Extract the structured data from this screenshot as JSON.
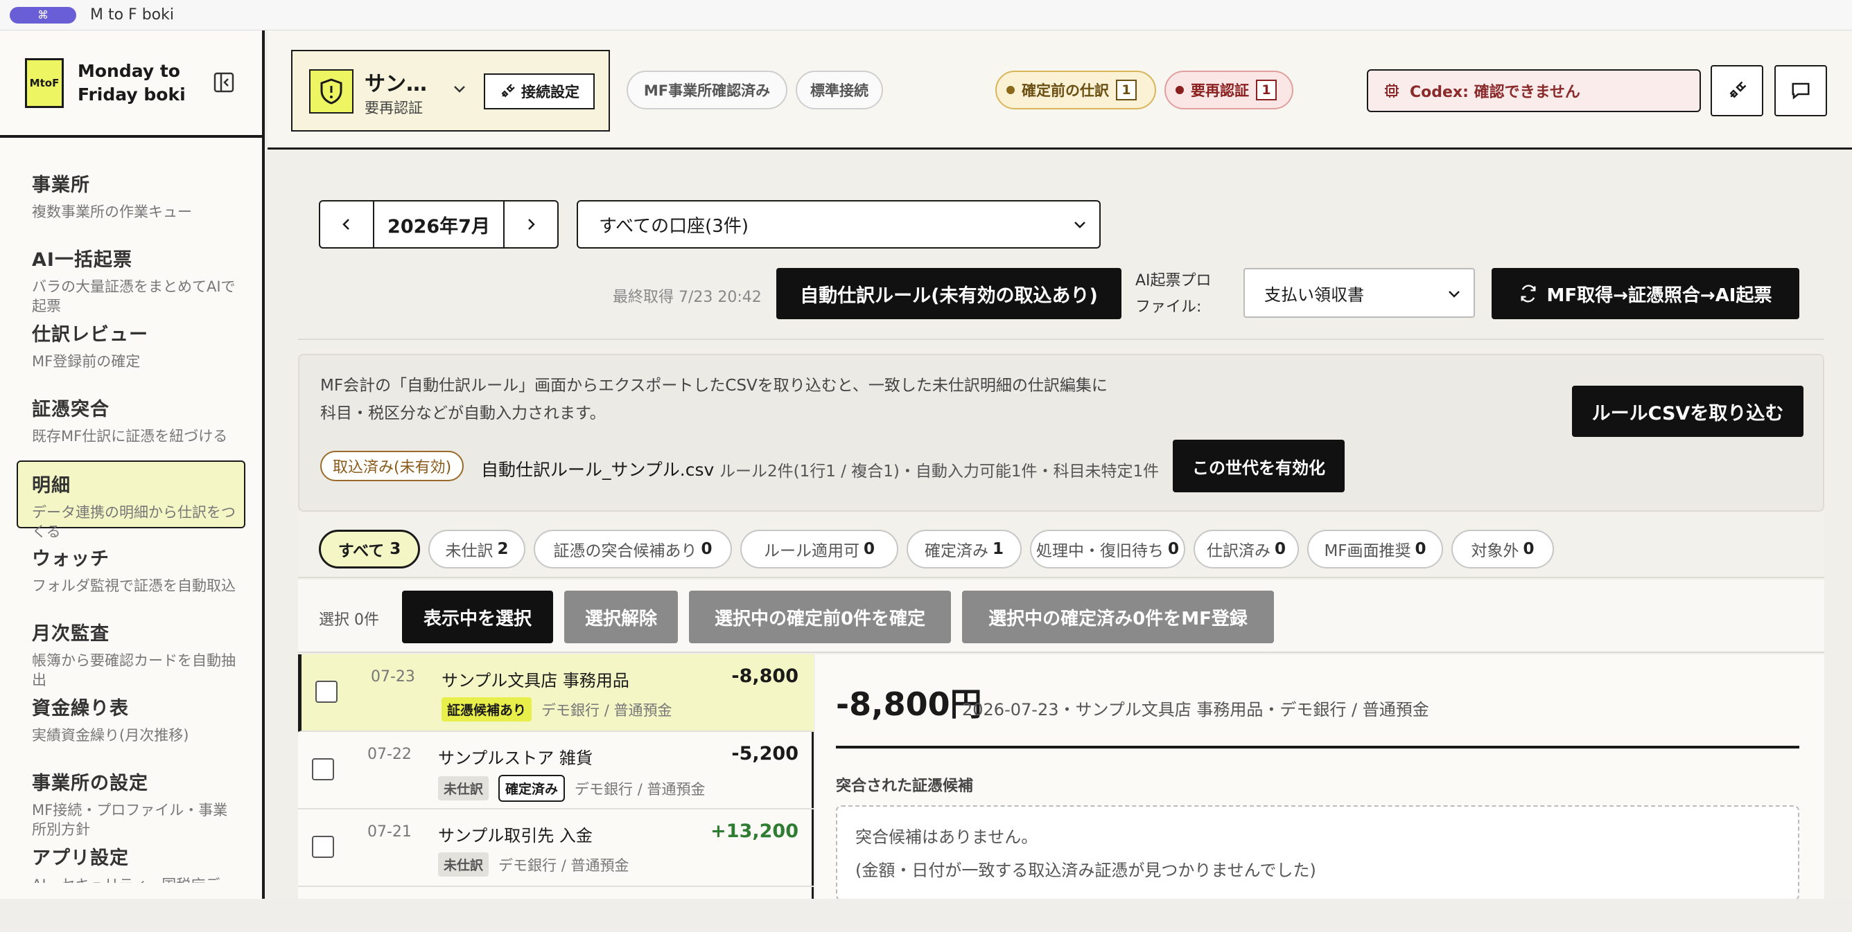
{
  "titlebar": {
    "pill_icon": "⌘",
    "title": "M to F boki"
  },
  "brand": {
    "logo": "MtoF",
    "line1": "Monday to",
    "line2": "Friday boki"
  },
  "sidebar": {
    "items": [
      {
        "label": "事業所",
        "desc": "複数事業所の作業キュー"
      },
      {
        "label": "AI一括起票",
        "desc": "バラの大量証憑をまとめてAIで起票"
      },
      {
        "label": "仕訳レビュー",
        "desc": "MF登録前の確定"
      },
      {
        "label": "証憑突合",
        "desc": "既存MF仕訳に証憑を紐づける"
      },
      {
        "label": "明細",
        "desc": "データ連携の明細から仕訳をつくる",
        "active": true
      },
      {
        "label": "ウォッチ",
        "desc": "フォルダ監視で証憑を自動取込"
      },
      {
        "label": "月次監査",
        "desc": "帳簿から要確認カードを自動抽出"
      },
      {
        "label": "資金繰り表",
        "desc": "実績資金繰り(月次推移)"
      },
      {
        "label": "事業所の設定",
        "desc": "MF接続・プロファイル・事業所別方針"
      },
      {
        "label": "アプリ設定",
        "desc": "AI・セキュリティ・国税庁データ・アプリ情報"
      }
    ]
  },
  "header": {
    "office_name": "サン…",
    "office_status": "要再認証",
    "connect_button": "接続設定",
    "pill_mf_confirmed": "MF事業所確認済み",
    "pill_standard": "標準接続",
    "status_pending": {
      "label": "確定前の仕訳",
      "count": "1",
      "color": "#b58a2a"
    },
    "status_reauth": {
      "label": "要再認証",
      "count": "1",
      "color": "#c0392b"
    },
    "codex": "Codex: 確認できません"
  },
  "main": {
    "month": "2026年7月",
    "account_select": "すべての口座(3件)",
    "last_fetch": "最終取得 7/23 20:42",
    "auto_rule_button": "自動仕訳ルール(未有効の取込あり)",
    "ai_profile_label_1": "AI起票プロ",
    "ai_profile_label_2": "ファイル:",
    "profile_value": "支払い領収書",
    "run_button": "MF取得→証憑照合→AI起票",
    "info_text": "MF会計の「自動仕訳ルール」画面からエクスポートしたCSVを取り込むと、一致した未仕訳明細の仕訳編集に科目・税区分などが自動入力されます。",
    "import_button": "ルールCSVを取り込む",
    "import_status": "取込済み(未有効)",
    "csv_name": "自動仕訳ルール_サンプル.csv",
    "rule_summary": "ルール2件(1行1 / 複合1)・自動入力可能1件・科目未特定1件",
    "enable_button": "この世代を有効化",
    "filters": [
      {
        "label": "すべて",
        "count": "3"
      },
      {
        "label": "未仕訳",
        "count": "2"
      },
      {
        "label": "証憑の突合候補あり",
        "count": "0"
      },
      {
        "label": "ルール適用可",
        "count": "0"
      },
      {
        "label": "確定済み",
        "count": "1"
      },
      {
        "label": "処理中・復旧待ち",
        "count": "0"
      },
      {
        "label": "仕訳済み",
        "count": "0"
      },
      {
        "label": "MF画面推奨",
        "count": "0"
      },
      {
        "label": "対象外",
        "count": "0"
      }
    ],
    "selection_count": "選択 0件",
    "select_visible": "表示中を選択",
    "deselect": "選択解除",
    "confirm_selected": "選択中の確定前0件を確定",
    "register_selected": "選択中の確定済み0件をMF登録"
  },
  "rows": [
    {
      "date": "07-23",
      "title": "サンプル文具店 事務用品",
      "amount": "-8,800",
      "badge1": "証憑候補あり",
      "badge2": "",
      "account": "デモ銀行 / 普通預金"
    },
    {
      "date": "07-22",
      "title": "サンプルストア 雑貨",
      "amount": "-5,200",
      "badge1": "未仕訳",
      "badge2": "確定済み",
      "account": "デモ銀行 / 普通預金"
    },
    {
      "date": "07-21",
      "title": "サンプル取引先 入金",
      "amount": "+13,200",
      "badge1": "未仕訳",
      "badge2": "",
      "account": "デモ銀行 / 普通預金"
    }
  ],
  "detail": {
    "amount": "-8,800円",
    "meta": "2026-07-23・サンプル文具店 事務用品・デモ銀行 / 普通預金",
    "candidates_heading": "突合された証憑候補",
    "no_candidates": "突合候補はありません。",
    "no_candidates_note": "(金額・日付が一致する取込済み証憑が見つかりませんでした)"
  },
  "colors": {
    "accent_yellow": "#eef562",
    "positive": "#2e7d32",
    "danger": "#8a2a2a"
  }
}
